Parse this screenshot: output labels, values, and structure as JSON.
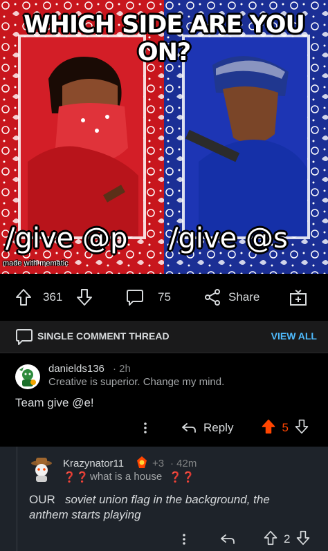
{
  "post": {
    "meme_title": "WHICH SIDE ARE YOU ON?",
    "caption_left": "/give @p",
    "caption_right": "/give @s",
    "watermark": "made with mematic",
    "upvotes": "361",
    "comments": "75",
    "share_label": "Share"
  },
  "thread": {
    "label": "SINGLE COMMENT THREAD",
    "view_all": "VIEW ALL"
  },
  "comments": [
    {
      "username": "danields136",
      "time": "2h",
      "flair": "Creative is superior. Change my mind.",
      "body": "Team give @e!",
      "reply_label": "Reply",
      "score": "5",
      "vote_color": "#ff4500"
    },
    {
      "username": "Krazynator11",
      "awards": "+3",
      "time": "42m",
      "flair_prefix": "❓❓",
      "flair": "what is a house",
      "flair_suffix": "❓❓",
      "body_prefix": "OUR",
      "body_italic": "soviet union flag in the background, the anthem starts playing",
      "score": "2"
    }
  ],
  "colors": {
    "red_panel": "#c8161d",
    "blue_panel": "#1b2f95",
    "link_blue": "#4fbcff",
    "upvote_orange": "#ff4500"
  },
  "icons": [
    "upvote-icon",
    "downvote-icon",
    "comment-icon",
    "share-icon",
    "gift-icon",
    "more-icon",
    "reply-icon",
    "award-icon"
  ]
}
